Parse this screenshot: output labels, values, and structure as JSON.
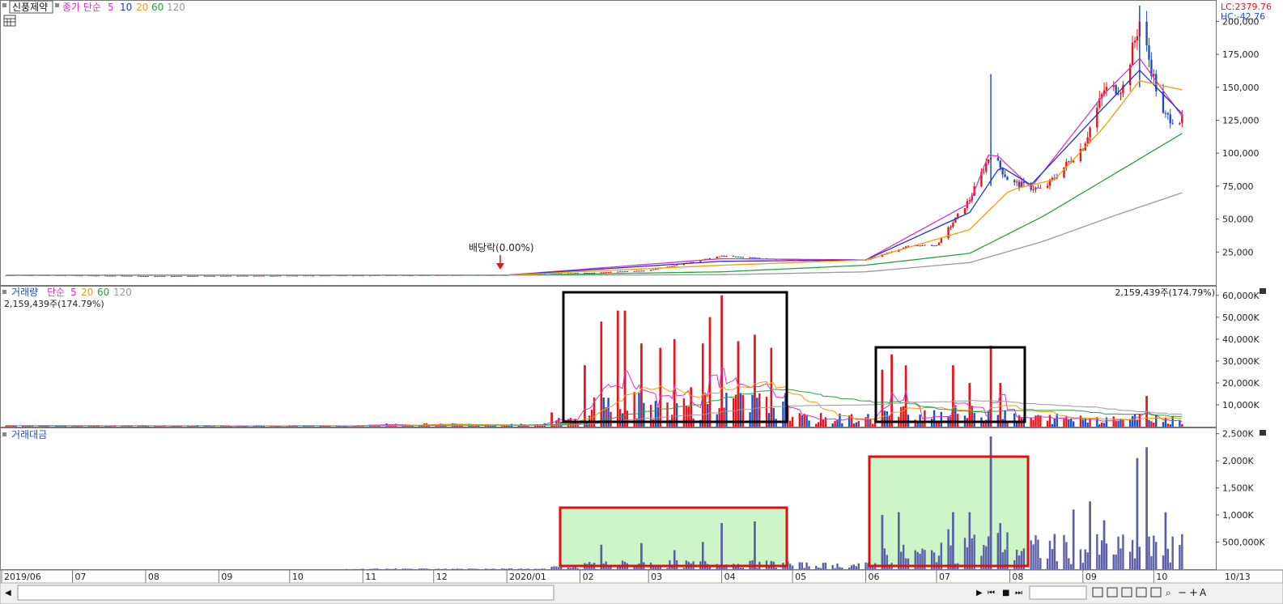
{
  "price_pane": {
    "stock_name": "신풍제약",
    "legend_label": "종가 단순",
    "ma_periods": [
      "5",
      "10",
      "20",
      "60",
      "120"
    ],
    "lc_text": "LC:2379.76",
    "hc_text": "HC:-42.76",
    "annotation": "배당락(0.00%)"
  },
  "volume_pane": {
    "legend_label": "거래량",
    "legend_sub": "단순",
    "ma_periods": [
      "5",
      "20",
      "60",
      "120"
    ],
    "value_left": "2,159,439주(174.79%)",
    "value_right": "2,159,439주(174.79%)"
  },
  "amount_pane": {
    "legend_label": "거래대금"
  },
  "x_axis": {
    "labels": [
      "2019/06",
      "07",
      "08",
      "09",
      "10",
      "11",
      "12",
      "2020/01",
      "02",
      "03",
      "04",
      "05",
      "06",
      "07",
      "08",
      "09",
      "10",
      "10/13"
    ]
  },
  "toolbar": {
    "a_label": "A"
  },
  "colors": {
    "up": "#e8141b",
    "down": "#1d4fc4",
    "ma5": "#d633c8",
    "ma10": "#2233cc",
    "ma20": "#f0a000",
    "ma60": "#27a040",
    "ma120": "#999999",
    "amount": "#5b5fa8",
    "highlight_fill": "#ccf5c8",
    "highlight_stroke": "#e01010"
  },
  "chart_data": [
    {
      "type": "line",
      "title": "종가 단순",
      "series": [
        {
          "name": "종가",
          "x": [
            "2019-06",
            "2019-07",
            "2019-08",
            "2019-09",
            "2019-10",
            "2019-11",
            "2019-12",
            "2020-01",
            "2020-02",
            "2020-03",
            "2020-04",
            "2020-05",
            "2020-06",
            "2020-06-20",
            "2020-07-01",
            "2020-07-15",
            "2020-07-24",
            "2020-08-01",
            "2020-08-15",
            "2020-09-01",
            "2020-09-10",
            "2020-09-18",
            "2020-09-25",
            "2020-10-05",
            "2020-10-13"
          ],
          "values": [
            7500,
            7300,
            6800,
            6900,
            7100,
            7300,
            7400,
            7600,
            9000,
            11000,
            22000,
            19000,
            19000,
            30000,
            30000,
            65000,
            100000,
            78000,
            72000,
            105000,
            148000,
            150000,
            200000,
            128000,
            125000
          ]
        },
        {
          "name": "5",
          "x": [
            "2019-06",
            "2020-01",
            "2020-04",
            "2020-06",
            "2020-07-15",
            "2020-07-24",
            "2020-08-10",
            "2020-09-10",
            "2020-09-25",
            "2020-10-13"
          ],
          "values": [
            7400,
            7500,
            20000,
            19000,
            62000,
            103000,
            74000,
            145000,
            172000,
            128000
          ]
        },
        {
          "name": "10",
          "x": [
            "2019-06",
            "2020-01",
            "2020-04",
            "2020-06",
            "2020-07-15",
            "2020-07-28",
            "2020-08-10",
            "2020-09-10",
            "2020-09-25",
            "2020-10-13"
          ],
          "values": [
            7400,
            7500,
            18000,
            19000,
            55000,
            90000,
            76000,
            135000,
            163000,
            130000
          ]
        },
        {
          "name": "20",
          "x": [
            "2019-06",
            "2020-01",
            "2020-04",
            "2020-06",
            "2020-07-15",
            "2020-08-01",
            "2020-08-20",
            "2020-09-10",
            "2020-09-25",
            "2020-10-13"
          ],
          "values": [
            7500,
            7500,
            15000,
            19000,
            42000,
            72000,
            80000,
            120000,
            155000,
            148000
          ]
        },
        {
          "name": "60",
          "x": [
            "2019-06",
            "2020-01",
            "2020-04",
            "2020-06",
            "2020-07-15",
            "2020-08-15",
            "2020-09-15",
            "2020-10-13"
          ],
          "values": [
            7400,
            7400,
            10000,
            15000,
            24000,
            52000,
            85000,
            115000
          ]
        },
        {
          "name": "120",
          "x": [
            "2019-06",
            "2020-01",
            "2020-04",
            "2020-06",
            "2020-07-15",
            "2020-08-15",
            "2020-09-15",
            "2020-10-13"
          ],
          "values": [
            7400,
            7400,
            7800,
            10000,
            17000,
            33000,
            53000,
            70000
          ]
        }
      ],
      "y_ticks": [
        25000,
        50000,
        75000,
        100000,
        125000,
        150000,
        175000,
        200000
      ],
      "ylim": [
        0,
        215000
      ]
    },
    {
      "type": "bar",
      "title": "거래량",
      "y_ticks_label": [
        "10,000K",
        "20,000K",
        "30,000K",
        "40,000K",
        "50,000K",
        "60,000K"
      ],
      "ylim": [
        0,
        64000
      ],
      "series": [
        {
          "name": "거래량",
          "x": [
            "2020-01-20",
            "2020-02-03",
            "2020-02-10",
            "2020-02-17",
            "2020-02-20",
            "2020-02-27",
            "2020-03-06",
            "2020-03-12",
            "2020-03-19",
            "2020-03-24",
            "2020-03-27",
            "2020-04-01",
            "2020-04-08",
            "2020-04-15",
            "2020-04-22",
            "2020-06-08",
            "2020-06-12",
            "2020-06-18",
            "2020-07-08",
            "2020-07-15",
            "2020-07-24",
            "2020-07-28",
            "2020-09-28"
          ],
          "values": [
            6500,
            28000,
            48000,
            53000,
            53000,
            38000,
            36000,
            40000,
            18000,
            38000,
            50000,
            60000,
            39000,
            42000,
            36000,
            26000,
            33000,
            28000,
            28000,
            20000,
            37000,
            20000,
            14000
          ]
        }
      ]
    },
    {
      "type": "bar",
      "title": "거래대금",
      "y_ticks_label": [
        "500,000K",
        "1,000K",
        "1,500K",
        "2,000K",
        "2,500K"
      ],
      "ylim": [
        0,
        2600000
      ],
      "series": [
        {
          "name": "거래대금",
          "x": [
            "2020-02-10",
            "2020-02-27",
            "2020-03-12",
            "2020-03-24",
            "2020-04-01",
            "2020-04-15",
            "2020-06-08",
            "2020-06-15",
            "2020-07-08",
            "2020-07-15",
            "2020-07-24",
            "2020-07-28",
            "2020-08-20",
            "2020-08-28",
            "2020-09-04",
            "2020-09-10",
            "2020-09-24",
            "2020-09-28",
            "2020-10-06"
          ],
          "values": [
            450000,
            480000,
            350000,
            500000,
            850000,
            880000,
            1000000,
            1050000,
            1050000,
            1050000,
            2450000,
            850000,
            650000,
            1100000,
            1250000,
            900000,
            2050000,
            2250000,
            1050000
          ]
        }
      ]
    }
  ]
}
